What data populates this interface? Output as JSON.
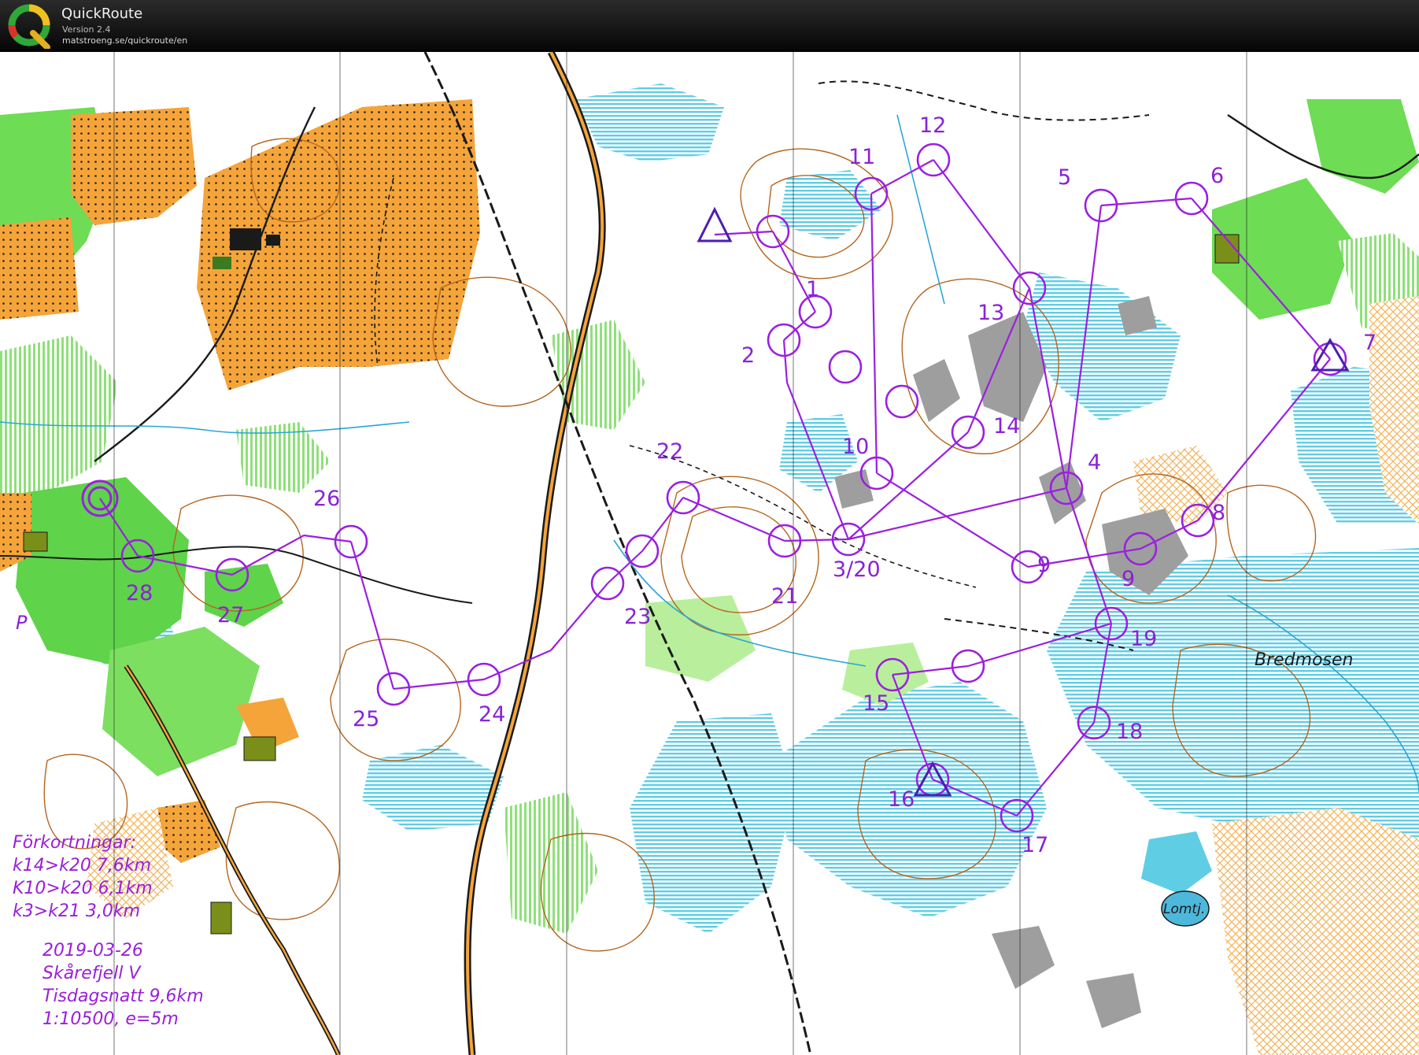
{
  "window": {
    "app_name": "QuickRoute",
    "version": "Version 2.4",
    "url": "matstroeng.se/quickroute/en"
  },
  "map": {
    "colors": {
      "course": "#9b1fe0",
      "forest": "#ffffff",
      "open_land": "#f5a43a",
      "green": "#5fd34a",
      "marsh": "#7ed3e6",
      "contour": "#b5651d"
    },
    "place_names": [
      "Bredmosen",
      "Lomtj."
    ],
    "parking_symbol": "P",
    "controls": [
      {
        "label": "1"
      },
      {
        "label": "2"
      },
      {
        "label": "3/20"
      },
      {
        "label": "4"
      },
      {
        "label": "5"
      },
      {
        "label": "6"
      },
      {
        "label": "7"
      },
      {
        "label": "8"
      },
      {
        "label": "9"
      },
      {
        "label": "9"
      },
      {
        "label": "10"
      },
      {
        "label": "11"
      },
      {
        "label": "12"
      },
      {
        "label": "13"
      },
      {
        "label": "14"
      },
      {
        "label": "15"
      },
      {
        "label": "16"
      },
      {
        "label": "17"
      },
      {
        "label": "18"
      },
      {
        "label": "19"
      },
      {
        "label": "21"
      },
      {
        "label": "22"
      },
      {
        "label": "23"
      },
      {
        "label": "24"
      },
      {
        "label": "25"
      },
      {
        "label": "26"
      },
      {
        "label": "27"
      },
      {
        "label": "28"
      }
    ]
  },
  "legend": {
    "abbrev_title": "Förkortningar:",
    "abbrev_lines": [
      "k14>k20 7,6km",
      "K10>k20 6,1km",
      "k3>k21 3,0km"
    ],
    "info_lines": [
      "2019-03-26",
      "Skårefjell V",
      "Tisdagsnatt 9,6km",
      "1:10500, e=5m"
    ]
  }
}
